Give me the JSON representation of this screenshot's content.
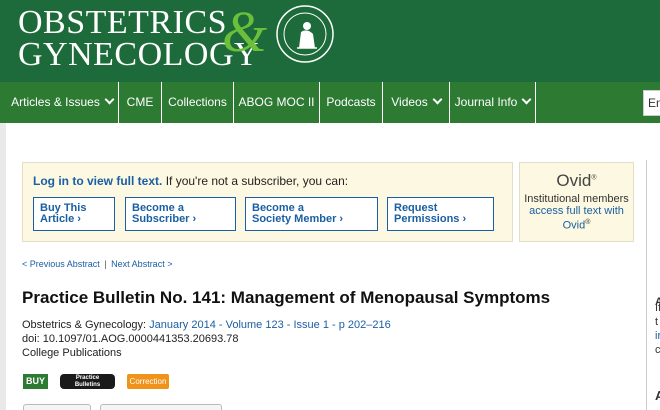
{
  "header": {
    "logo_line1": "OBSTETRICS",
    "logo_line2": "GYNECOLOGY",
    "logo_amp": "&",
    "brand_green": "#1d6b3a",
    "accent_green": "#6cbf3a"
  },
  "nav": {
    "items": [
      {
        "label": "Articles & Issues",
        "dropdown": true
      },
      {
        "label": "CME",
        "dropdown": false
      },
      {
        "label": "Collections",
        "dropdown": false
      },
      {
        "label": "ABOG MOC II",
        "dropdown": false
      },
      {
        "label": "Podcasts",
        "dropdown": false
      },
      {
        "label": "Videos",
        "dropdown": true
      },
      {
        "label": "Journal Info",
        "dropdown": true
      }
    ],
    "search_value": "En"
  },
  "access": {
    "login_link": "Log in to view full text.",
    "subscriber_text": "If you're not a subscriber, you can:",
    "buttons": [
      {
        "line1": "Buy This",
        "line2": "Article"
      },
      {
        "line1": "Become a",
        "line2": "Subscriber"
      },
      {
        "line1": "Become a",
        "line2": "Society Member"
      },
      {
        "line1": "Request",
        "line2": "Permissions"
      }
    ]
  },
  "ovid": {
    "brand": "Ovid",
    "text_before": "Institutional members",
    "link": "access full text with Ovid",
    "reg": "®"
  },
  "article": {
    "prev": "< Previous Abstract",
    "sep": "|",
    "next": "Next Abstract >",
    "title": "Practice Bulletin No. 141: Management of Menopausal Symptoms",
    "journal": "Obstetrics & Gynecology:",
    "issue_link": "January 2014 - Volume 123 - Issue 1 - p 202–216",
    "doi": "doi: 10.1097/01.AOG.0000441353.20693.78",
    "publisher": "College Publications"
  },
  "badges": {
    "buy": "BUY",
    "practice_line1": "Practice",
    "practice_line2": "Bulletins",
    "correction": "Correction"
  },
  "right_strip": {
    "letter_a": "A",
    "letters": [
      "If",
      "t",
      "ir",
      "c"
    ]
  }
}
